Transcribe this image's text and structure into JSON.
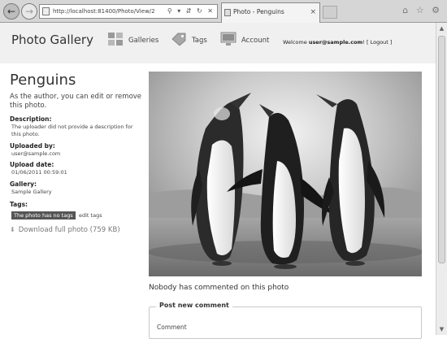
{
  "browser": {
    "back_icon": "back-arrow-icon",
    "forward_icon": "forward-arrow-icon",
    "address": "http://localhost:81400/Photo/View/2",
    "address_tools": "⚲ ▾ ⇵ ↻ ✕",
    "tab_title": "Photo - Penguins",
    "tab_close": "×",
    "window_icons": "⌂ ☆ ⚙"
  },
  "header": {
    "site_title": "Photo Gallery",
    "nav": [
      {
        "label": "Galleries",
        "icon": "galleries-icon"
      },
      {
        "label": "Tags",
        "icon": "tag-icon"
      },
      {
        "label": "Account",
        "icon": "monitor-icon"
      }
    ],
    "welcome_prefix": "Welcome ",
    "welcome_user": "user@sample.com",
    "welcome_sep": "! [ ",
    "logout": "Logout",
    "welcome_suffix": " ]"
  },
  "photo": {
    "title": "Penguins",
    "author_text_1": "As the author, you can ",
    "edit_link": "edit",
    "author_text_2": " or ",
    "remove_link": "remove",
    "author_text_3": " this photo.",
    "description_label": "Description:",
    "description_value": "The uploader did not provide a description for this photo.",
    "uploaded_by_label": "Uploaded by:",
    "uploaded_by_value": "user@sample.com",
    "upload_date_label": "Upload date:",
    "upload_date_value": "01/06/2011 00:59:01",
    "gallery_label": "Gallery:",
    "gallery_value": "Sample Gallery",
    "tags_label": "Tags:",
    "tags_badge": "The photo has no tags",
    "edit_tags": "edit tags",
    "download": "Download full photo (759 KB)"
  },
  "comments": {
    "none_text": "Nobody has commented on this photo",
    "legend": "Post new comment",
    "comment_label": "Comment"
  },
  "colors": {
    "header_bg": "#f0f0f0",
    "tag_badge_bg": "#555555",
    "chrome_bg": "#d6d6d6"
  }
}
